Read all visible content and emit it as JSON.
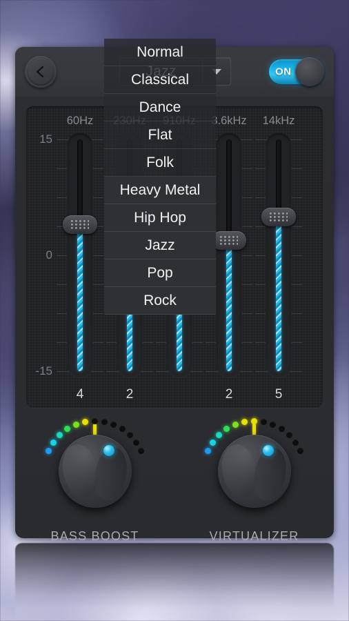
{
  "header": {
    "back_icon": "chevron-left-icon",
    "preset_selected": "Jazz",
    "caret_icon": "chevron-down-icon",
    "toggle_label": "ON",
    "toggle_state": "on",
    "toggle_accent": "#1eb4e8"
  },
  "dropdown": {
    "open": true,
    "items": [
      {
        "label": "Normal",
        "style": "trans"
      },
      {
        "label": "Classical",
        "style": "trans"
      },
      {
        "label": "Dance",
        "style": "trans"
      },
      {
        "label": "Flat",
        "style": "trans"
      },
      {
        "label": "Folk",
        "style": "trans"
      },
      {
        "label": "Heavy Metal",
        "style": "opaque"
      },
      {
        "label": "Hip Hop",
        "style": "opaque"
      },
      {
        "label": "Jazz",
        "style": "opaque"
      },
      {
        "label": "Pop",
        "style": "opaque"
      },
      {
        "label": "Rock",
        "style": "opaque"
      }
    ]
  },
  "equalizer": {
    "scale_labels": [
      "15",
      "0",
      "-15"
    ],
    "range_db": [
      -15,
      15
    ],
    "accent": "#2ab6e8",
    "bands": [
      {
        "freq": "60Hz",
        "value": "4"
      },
      {
        "freq": "230Hz",
        "value": "2"
      },
      {
        "freq": "910Hz",
        "value": ""
      },
      {
        "freq": "3.6kHz",
        "value": "2"
      },
      {
        "freq": "14kHz",
        "value": "5"
      }
    ]
  },
  "effects": [
    {
      "name": "BASS BOOST",
      "lit_colors": [
        "#1e9bf0",
        "#15d4e8",
        "#17d9c0",
        "#2ae05a",
        "#7ae021",
        "#e8e000"
      ],
      "lit_count": 6,
      "dot_count": 13,
      "indicator_color": "#2ec4f0"
    },
    {
      "name": "VIRTUALIZER",
      "lit_colors": [
        "#1e9bf0",
        "#15d4e8",
        "#17d9c0",
        "#2ae05a",
        "#7ae021",
        "#e8e000",
        "#e8e000"
      ],
      "lit_count": 7,
      "dot_count": 13,
      "indicator_color": "#2ec4f0"
    }
  ]
}
